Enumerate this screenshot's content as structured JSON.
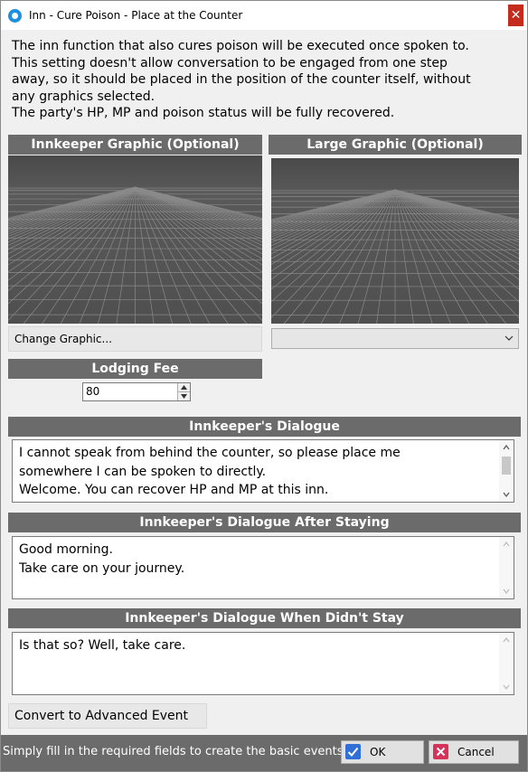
{
  "window": {
    "title": "Inn - Cure Poison - Place at the Counter",
    "close_glyph": "✕"
  },
  "description": [
    "The inn function that also cures poison will be executed once spoken to.",
    "This setting doesn't allow conversation to be engaged from one step",
    "away, so it should be placed in the position of the counter itself, without",
    "any graphics selected.",
    "The party's HP, MP and poison status will be fully recovered."
  ],
  "innkeeper_graphic": {
    "header": "Innkeeper Graphic (Optional)",
    "button_label": "Change Graphic..."
  },
  "large_graphic": {
    "header": "Large Graphic (Optional)",
    "select_value": ""
  },
  "lodging_fee": {
    "header": "Lodging Fee",
    "value": "80"
  },
  "dialogue": {
    "header": "Innkeeper's Dialogue",
    "lines": [
      "I cannot speak from behind the counter, so please place me",
      "somewhere I can be spoken to directly.",
      "Welcome. You can recover HP and MP at this inn."
    ]
  },
  "dialogue_after": {
    "header": "Innkeeper's Dialogue After Staying",
    "lines": [
      "Good morning.",
      "Take care on your journey."
    ]
  },
  "dialogue_no_stay": {
    "header": "Innkeeper's Dialogue When Didn't Stay",
    "lines": [
      "Is that so? Well, take care."
    ]
  },
  "convert_button": "Convert to Advanced Event",
  "footer": {
    "hint": "Simply fill in the required fields to create the basic events",
    "ok_label": "OK",
    "cancel_label": "Cancel"
  },
  "colors": {
    "header_bg": "#6b6b6b",
    "ok_accent": "#2f6fd6",
    "cancel_accent": "#d6335a"
  },
  "icons": [
    "app-icon",
    "close-icon",
    "chevron-down-icon",
    "spin-up-icon",
    "spin-down-icon",
    "check-icon",
    "x-icon"
  ]
}
